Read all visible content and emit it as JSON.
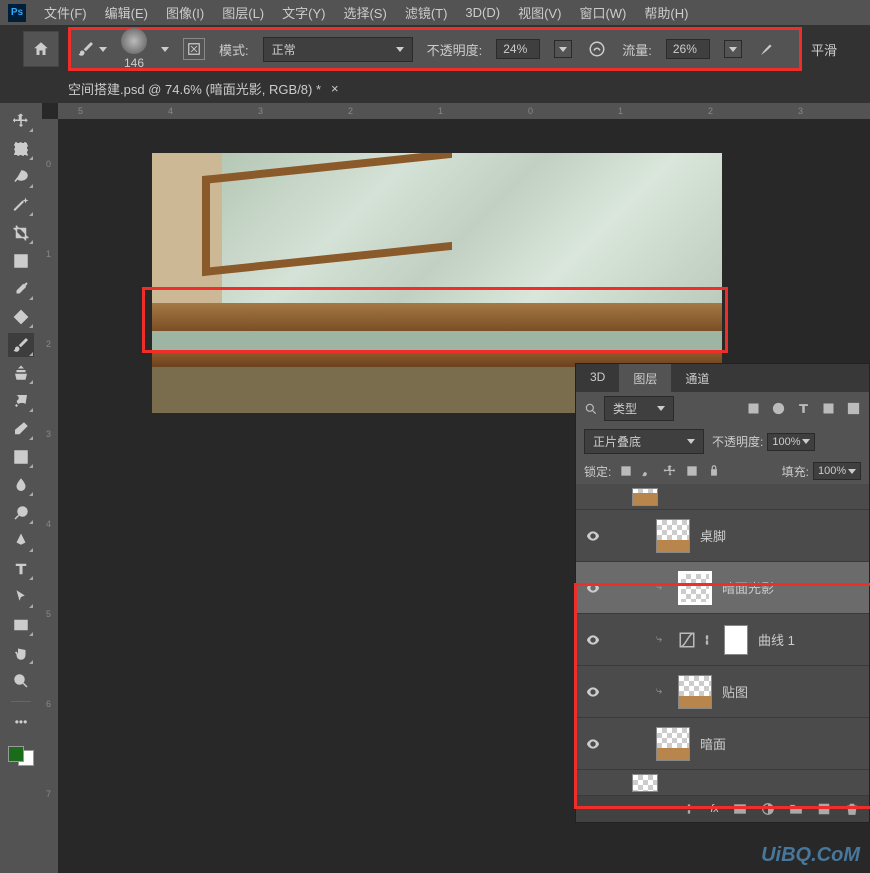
{
  "menu": {
    "items": [
      "文件(F)",
      "编辑(E)",
      "图像(I)",
      "图层(L)",
      "文字(Y)",
      "选择(S)",
      "滤镜(T)",
      "3D(D)",
      "视图(V)",
      "窗口(W)",
      "帮助(H)"
    ]
  },
  "options": {
    "brush_size": "146",
    "mode_label": "模式:",
    "mode_value": "正常",
    "opacity_label": "不透明度:",
    "opacity_value": "24%",
    "flow_label": "流量:",
    "flow_value": "26%",
    "smooth_label": "平滑"
  },
  "tab": {
    "title": "空间搭建.psd @ 74.6% (暗面光影, RGB/8) *",
    "close": "×"
  },
  "ruler_h": [
    "5",
    "4",
    "3",
    "2",
    "1",
    "0",
    "1",
    "2",
    "3"
  ],
  "ruler_v": [
    "0",
    "1",
    "2",
    "3",
    "4",
    "5",
    "6",
    "7"
  ],
  "panel": {
    "tabs": [
      "3D",
      "图层",
      "通道"
    ],
    "filter_label": "类型",
    "blend_mode": "正片叠底",
    "opacity_label": "不透明度:",
    "opacity_value": "100%",
    "lock_label": "锁定:",
    "fill_label": "填充:",
    "fill_value": "100%",
    "layers": [
      {
        "name": "桌脚"
      },
      {
        "name": "暗面光影"
      },
      {
        "name": "曲线 1"
      },
      {
        "name": "贴图"
      },
      {
        "name": "暗面"
      }
    ],
    "fx_label": "fx"
  },
  "watermark": "UiBQ.CoM"
}
